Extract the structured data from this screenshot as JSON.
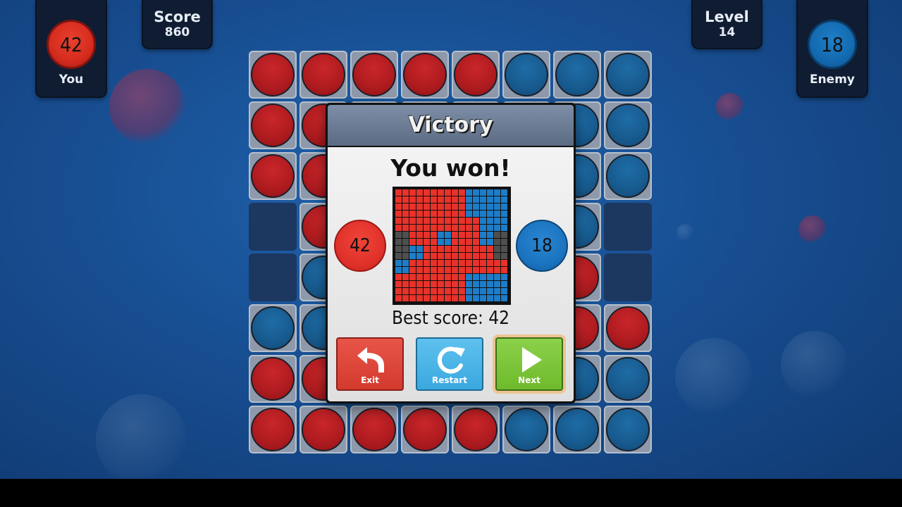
{
  "hud": {
    "player": {
      "count": "42",
      "name": "You",
      "color": "#d52c1e"
    },
    "score": {
      "title": "Score",
      "value": "860"
    },
    "level": {
      "title": "Level",
      "value": "14"
    },
    "enemy": {
      "count": "18",
      "name": "Enemy",
      "color": "#136ab0"
    }
  },
  "board": {
    "rows": [
      [
        "red",
        "red",
        "red",
        "red",
        "red",
        "blue",
        "blue",
        "blue"
      ],
      [
        "red",
        "red",
        "red",
        "red",
        "red",
        "blue",
        "blue",
        "blue"
      ],
      [
        "red",
        "red",
        "red",
        "red",
        "red",
        "blue",
        "blue",
        "blue"
      ],
      [
        "empty",
        "red",
        "red",
        "red",
        "red",
        "blue",
        "blue",
        "empty"
      ],
      [
        "empty",
        "blue",
        "red",
        "red",
        "red",
        "red",
        "red",
        "empty"
      ],
      [
        "blue",
        "blue",
        "red",
        "red",
        "red",
        "red",
        "red",
        "red"
      ],
      [
        "red",
        "red",
        "red",
        "red",
        "red",
        "blue",
        "blue",
        "blue"
      ],
      [
        "red",
        "red",
        "red",
        "red",
        "red",
        "blue",
        "blue",
        "blue"
      ]
    ]
  },
  "dialog": {
    "title": "Victory",
    "heading": "You won!",
    "player_count": "42",
    "enemy_count": "18",
    "best_score": "Best score: 42",
    "minimap": [
      [
        "r",
        "r",
        "r",
        "r",
        "r",
        "b",
        "b",
        "b"
      ],
      [
        "r",
        "r",
        "r",
        "r",
        "r",
        "b",
        "b",
        "b"
      ],
      [
        "r",
        "r",
        "r",
        "r",
        "r",
        "r",
        "b",
        "b"
      ],
      [
        "g",
        "r",
        "r",
        "b",
        "r",
        "r",
        "b",
        "g"
      ],
      [
        "g",
        "b",
        "r",
        "r",
        "r",
        "r",
        "r",
        "g"
      ],
      [
        "b",
        "r",
        "r",
        "r",
        "r",
        "r",
        "r",
        "r"
      ],
      [
        "r",
        "r",
        "r",
        "r",
        "r",
        "b",
        "b",
        "b"
      ],
      [
        "r",
        "r",
        "r",
        "r",
        "r",
        "b",
        "b",
        "b"
      ]
    ],
    "minimap_colors": {
      "r": "#e8322a",
      "b": "#1d7dc8",
      "g": "#4f4f4f"
    },
    "buttons": {
      "exit": "Exit",
      "restart": "Restart",
      "next": "Next"
    }
  }
}
